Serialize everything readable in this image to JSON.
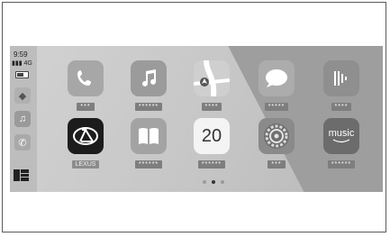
{
  "status": {
    "time": "9:59",
    "signal": "4G"
  },
  "apps": [
    {
      "key": "phone",
      "label": "***",
      "icon": "phone-icon"
    },
    {
      "key": "music",
      "label": "******",
      "icon": "music-icon"
    },
    {
      "key": "maps",
      "label": "****",
      "icon": "maps-icon"
    },
    {
      "key": "messages",
      "label": "*****",
      "icon": "messages-icon"
    },
    {
      "key": "podcasts",
      "label": "****",
      "icon": "audio-app-icon"
    },
    {
      "key": "lexus",
      "label": "LEXUS",
      "icon": "lexus-logo-icon"
    },
    {
      "key": "books",
      "label": "******",
      "icon": "book-icon"
    },
    {
      "key": "calendar",
      "label": "******",
      "icon": "calendar-icon",
      "date": "20"
    },
    {
      "key": "settings",
      "label": "***",
      "icon": "gear-icon"
    },
    {
      "key": "amazon",
      "label": "******",
      "icon": "amazon-music-icon",
      "word": "music"
    }
  ],
  "pager": {
    "count": 3,
    "active": 1
  }
}
